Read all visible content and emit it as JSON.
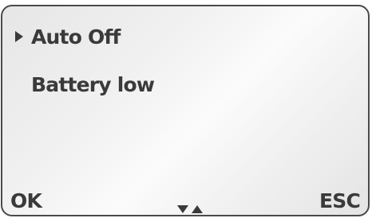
{
  "menu": {
    "items": [
      {
        "label": "Auto Off",
        "selected": true
      },
      {
        "label": "Battery low",
        "selected": false
      }
    ]
  },
  "softkeys": {
    "left_label": "OK",
    "right_label": "ESC"
  },
  "icons": {
    "selection": "triangle-right-icon",
    "nav_down": "triangle-down-icon",
    "nav_up": "triangle-up-icon"
  },
  "colors": {
    "text": "#3a3a3a",
    "frame": "#4a4a4a",
    "display_background": "#f0f0f0"
  }
}
